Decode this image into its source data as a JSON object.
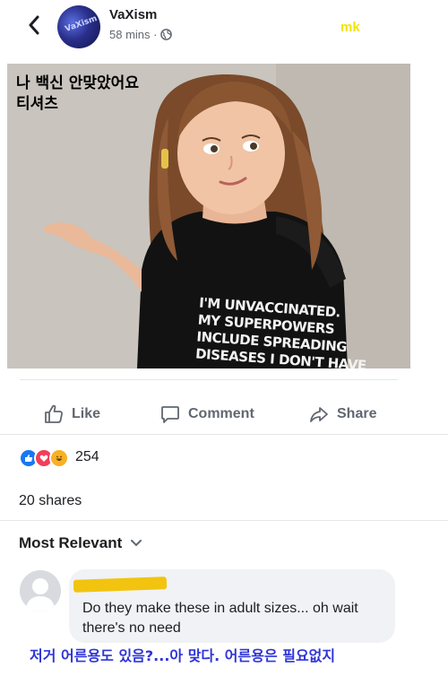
{
  "header": {
    "page_name": "VaXism",
    "time": "58 mins ·",
    "avatar_text": "VaXism",
    "watermark": "mk"
  },
  "post": {
    "caption_lines": [
      "나 백신 안맞았어요",
      "티셔츠"
    ],
    "shirt_lines": [
      "I'M UNVACCINATED.",
      "MY SUPERPOWERS",
      "INCLUDE SPREADING",
      "DISEASES I DON'T HAVE"
    ]
  },
  "actions": {
    "like": "Like",
    "comment": "Comment",
    "share": "Share"
  },
  "reactions": {
    "icons": [
      "like-reaction-icon",
      "love-reaction-icon",
      "haha-reaction-icon"
    ],
    "count": "254"
  },
  "shares": "20 shares",
  "sort": {
    "label": "Most Relevant"
  },
  "comment": {
    "text": "Do they make these in adult sizes... oh wait there's no need"
  },
  "translation": "저거 어른용도 있음?...아 맞다. 어른용은 필요없지",
  "colors": {
    "accent": "#1877f2",
    "watermark": "#f2e200",
    "translation": "#2f35d6",
    "redaction": "#f2c40f"
  }
}
